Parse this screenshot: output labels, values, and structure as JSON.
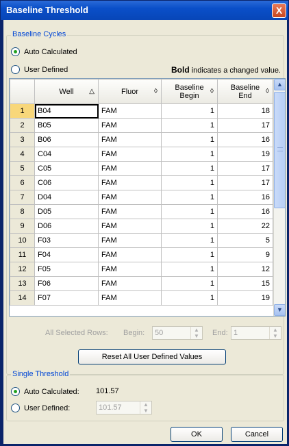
{
  "window": {
    "title": "Baseline Threshold",
    "close_label": "X"
  },
  "baseline_cycles": {
    "legend": "Baseline Cycles",
    "auto_label": "Auto Calculated",
    "user_label": "User Defined",
    "auto_selected": true,
    "hint_bold": "Bold",
    "hint_rest": " indicates a changed value."
  },
  "grid": {
    "columns": [
      "Well",
      "Fluor",
      "Baseline Begin",
      "Baseline End"
    ],
    "rows": [
      {
        "n": "1",
        "well": "B04",
        "fluor": "FAM",
        "begin": "1",
        "end": "18"
      },
      {
        "n": "2",
        "well": "B05",
        "fluor": "FAM",
        "begin": "1",
        "end": "17"
      },
      {
        "n": "3",
        "well": "B06",
        "fluor": "FAM",
        "begin": "1",
        "end": "16"
      },
      {
        "n": "4",
        "well": "C04",
        "fluor": "FAM",
        "begin": "1",
        "end": "19"
      },
      {
        "n": "5",
        "well": "C05",
        "fluor": "FAM",
        "begin": "1",
        "end": "17"
      },
      {
        "n": "6",
        "well": "C06",
        "fluor": "FAM",
        "begin": "1",
        "end": "17"
      },
      {
        "n": "7",
        "well": "D04",
        "fluor": "FAM",
        "begin": "1",
        "end": "16"
      },
      {
        "n": "8",
        "well": "D05",
        "fluor": "FAM",
        "begin": "1",
        "end": "16"
      },
      {
        "n": "9",
        "well": "D06",
        "fluor": "FAM",
        "begin": "1",
        "end": "22"
      },
      {
        "n": "10",
        "well": "F03",
        "fluor": "FAM",
        "begin": "1",
        "end": "5"
      },
      {
        "n": "11",
        "well": "F04",
        "fluor": "FAM",
        "begin": "1",
        "end": "9"
      },
      {
        "n": "12",
        "well": "F05",
        "fluor": "FAM",
        "begin": "1",
        "end": "12"
      },
      {
        "n": "13",
        "well": "F06",
        "fluor": "FAM",
        "begin": "1",
        "end": "15"
      },
      {
        "n": "14",
        "well": "F07",
        "fluor": "FAM",
        "begin": "1",
        "end": "19"
      }
    ]
  },
  "selected_rows": {
    "label": "All Selected Rows:",
    "begin_label": "Begin:",
    "begin_value": "50",
    "end_label": "End:",
    "end_value": "1"
  },
  "reset_label": "Reset All User Defined Values",
  "single_threshold": {
    "legend": "Single Threshold",
    "auto_label": "Auto Calculated:",
    "auto_value": "101.57",
    "user_label": "User Defined:",
    "user_value": "101.57",
    "auto_selected": true
  },
  "buttons": {
    "ok": "OK",
    "cancel": "Cancel"
  }
}
